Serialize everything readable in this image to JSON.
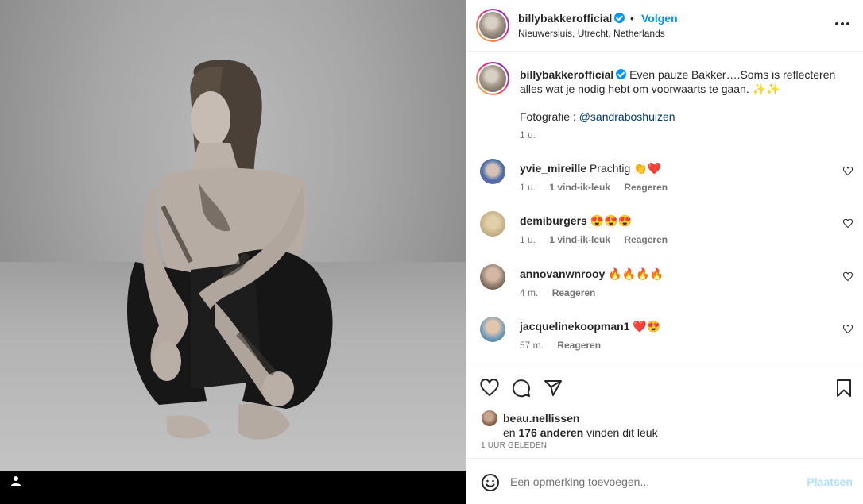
{
  "post": {
    "username": "billybakkerofficial",
    "dot": "•",
    "follow_label": "Volgen",
    "location": "Nieuwersluis, Utrecht, Netherlands",
    "caption": "Even pauze Bakker….Soms is reflecteren alles wat je nodig hebt om voorwaarts te gaan. ✨✨",
    "credit_prefix": "Fotografie : ",
    "credit_handle": "@sandraboshuizen",
    "caption_time": "1 u."
  },
  "comments": [
    {
      "user": "yvie_mireille",
      "text": "Prachtig 👏❤️",
      "time": "1 u.",
      "likes": "1 vind-ik-leuk",
      "reply": "Reageren",
      "avatar_color": "#4a6fa5"
    },
    {
      "user": "demiburgers",
      "text": "😍😍😍",
      "time": "1 u.",
      "likes": "1 vind-ik-leuk",
      "reply": "Reageren",
      "avatar_color": "#c8b48a"
    },
    {
      "user": "annovanwnrooy",
      "text": "🔥🔥🔥🔥",
      "time": "4 m.",
      "likes": "",
      "reply": "Reageren",
      "avatar_color": "#8c7868"
    },
    {
      "user": "jacquelinekoopman1",
      "text": "❤️😍",
      "time": "57 m.",
      "likes": "",
      "reply": "Reageren",
      "avatar_color": "#6f9bb8"
    }
  ],
  "likes": {
    "user": "beau.nellissen",
    "prefix": "en ",
    "count": "176 anderen",
    "suffix": " vinden dit leuk",
    "ago": "1 UUR GELEDEN"
  },
  "add_comment": {
    "placeholder": "Een opmerking toevoegen...",
    "post_label": "Plaatsen"
  },
  "icons": {
    "like": "heart-icon",
    "comment": "comment-icon",
    "share": "share-icon",
    "save": "bookmark-icon",
    "more": "more-icon",
    "emoji": "emoji-icon",
    "tag": "user-tag-icon"
  },
  "colors": {
    "accent": "#0095f6",
    "link": "#00376b",
    "muted": "#737373",
    "post_disabled": "#b2dffc"
  }
}
